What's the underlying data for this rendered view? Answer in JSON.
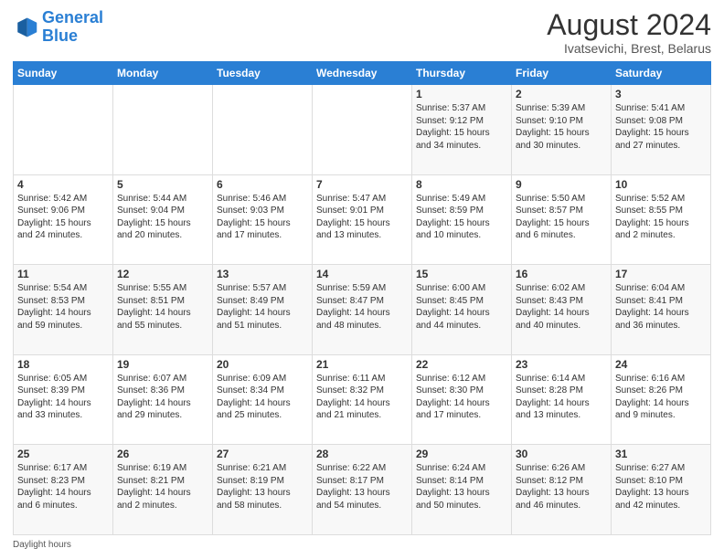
{
  "logo": {
    "line1": "General",
    "line2": "Blue"
  },
  "title": "August 2024",
  "subtitle": "Ivatsevichi, Brest, Belarus",
  "days_of_week": [
    "Sunday",
    "Monday",
    "Tuesday",
    "Wednesday",
    "Thursday",
    "Friday",
    "Saturday"
  ],
  "footer_note": "Daylight hours",
  "weeks": [
    [
      {
        "day": "",
        "info": ""
      },
      {
        "day": "",
        "info": ""
      },
      {
        "day": "",
        "info": ""
      },
      {
        "day": "",
        "info": ""
      },
      {
        "day": "1",
        "info": "Sunrise: 5:37 AM\nSunset: 9:12 PM\nDaylight: 15 hours\nand 34 minutes."
      },
      {
        "day": "2",
        "info": "Sunrise: 5:39 AM\nSunset: 9:10 PM\nDaylight: 15 hours\nand 30 minutes."
      },
      {
        "day": "3",
        "info": "Sunrise: 5:41 AM\nSunset: 9:08 PM\nDaylight: 15 hours\nand 27 minutes."
      }
    ],
    [
      {
        "day": "4",
        "info": "Sunrise: 5:42 AM\nSunset: 9:06 PM\nDaylight: 15 hours\nand 24 minutes."
      },
      {
        "day": "5",
        "info": "Sunrise: 5:44 AM\nSunset: 9:04 PM\nDaylight: 15 hours\nand 20 minutes."
      },
      {
        "day": "6",
        "info": "Sunrise: 5:46 AM\nSunset: 9:03 PM\nDaylight: 15 hours\nand 17 minutes."
      },
      {
        "day": "7",
        "info": "Sunrise: 5:47 AM\nSunset: 9:01 PM\nDaylight: 15 hours\nand 13 minutes."
      },
      {
        "day": "8",
        "info": "Sunrise: 5:49 AM\nSunset: 8:59 PM\nDaylight: 15 hours\nand 10 minutes."
      },
      {
        "day": "9",
        "info": "Sunrise: 5:50 AM\nSunset: 8:57 PM\nDaylight: 15 hours\nand 6 minutes."
      },
      {
        "day": "10",
        "info": "Sunrise: 5:52 AM\nSunset: 8:55 PM\nDaylight: 15 hours\nand 2 minutes."
      }
    ],
    [
      {
        "day": "11",
        "info": "Sunrise: 5:54 AM\nSunset: 8:53 PM\nDaylight: 14 hours\nand 59 minutes."
      },
      {
        "day": "12",
        "info": "Sunrise: 5:55 AM\nSunset: 8:51 PM\nDaylight: 14 hours\nand 55 minutes."
      },
      {
        "day": "13",
        "info": "Sunrise: 5:57 AM\nSunset: 8:49 PM\nDaylight: 14 hours\nand 51 minutes."
      },
      {
        "day": "14",
        "info": "Sunrise: 5:59 AM\nSunset: 8:47 PM\nDaylight: 14 hours\nand 48 minutes."
      },
      {
        "day": "15",
        "info": "Sunrise: 6:00 AM\nSunset: 8:45 PM\nDaylight: 14 hours\nand 44 minutes."
      },
      {
        "day": "16",
        "info": "Sunrise: 6:02 AM\nSunset: 8:43 PM\nDaylight: 14 hours\nand 40 minutes."
      },
      {
        "day": "17",
        "info": "Sunrise: 6:04 AM\nSunset: 8:41 PM\nDaylight: 14 hours\nand 36 minutes."
      }
    ],
    [
      {
        "day": "18",
        "info": "Sunrise: 6:05 AM\nSunset: 8:39 PM\nDaylight: 14 hours\nand 33 minutes."
      },
      {
        "day": "19",
        "info": "Sunrise: 6:07 AM\nSunset: 8:36 PM\nDaylight: 14 hours\nand 29 minutes."
      },
      {
        "day": "20",
        "info": "Sunrise: 6:09 AM\nSunset: 8:34 PM\nDaylight: 14 hours\nand 25 minutes."
      },
      {
        "day": "21",
        "info": "Sunrise: 6:11 AM\nSunset: 8:32 PM\nDaylight: 14 hours\nand 21 minutes."
      },
      {
        "day": "22",
        "info": "Sunrise: 6:12 AM\nSunset: 8:30 PM\nDaylight: 14 hours\nand 17 minutes."
      },
      {
        "day": "23",
        "info": "Sunrise: 6:14 AM\nSunset: 8:28 PM\nDaylight: 14 hours\nand 13 minutes."
      },
      {
        "day": "24",
        "info": "Sunrise: 6:16 AM\nSunset: 8:26 PM\nDaylight: 14 hours\nand 9 minutes."
      }
    ],
    [
      {
        "day": "25",
        "info": "Sunrise: 6:17 AM\nSunset: 8:23 PM\nDaylight: 14 hours\nand 6 minutes."
      },
      {
        "day": "26",
        "info": "Sunrise: 6:19 AM\nSunset: 8:21 PM\nDaylight: 14 hours\nand 2 minutes."
      },
      {
        "day": "27",
        "info": "Sunrise: 6:21 AM\nSunset: 8:19 PM\nDaylight: 13 hours\nand 58 minutes."
      },
      {
        "day": "28",
        "info": "Sunrise: 6:22 AM\nSunset: 8:17 PM\nDaylight: 13 hours\nand 54 minutes."
      },
      {
        "day": "29",
        "info": "Sunrise: 6:24 AM\nSunset: 8:14 PM\nDaylight: 13 hours\nand 50 minutes."
      },
      {
        "day": "30",
        "info": "Sunrise: 6:26 AM\nSunset: 8:12 PM\nDaylight: 13 hours\nand 46 minutes."
      },
      {
        "day": "31",
        "info": "Sunrise: 6:27 AM\nSunset: 8:10 PM\nDaylight: 13 hours\nand 42 minutes."
      }
    ]
  ]
}
